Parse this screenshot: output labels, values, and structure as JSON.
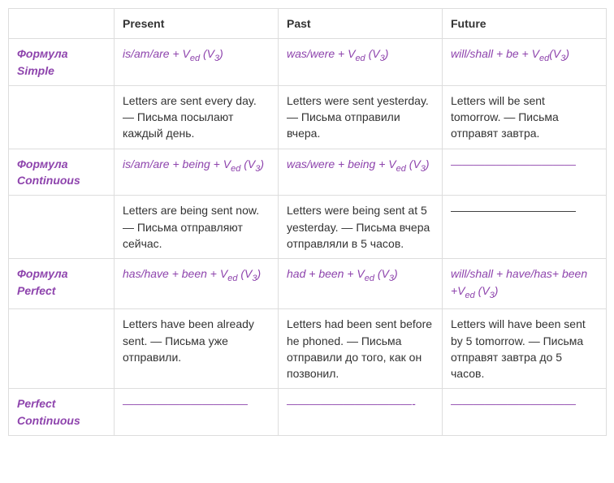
{
  "headers": {
    "present": "Present",
    "past": "Past",
    "future": "Future"
  },
  "rows": {
    "simple": {
      "label": "Формула Simple",
      "formula": {
        "present": {
          "prefix": "is/am/are + V",
          "sub": "ed",
          "suffix": " (V",
          "sub2": "3",
          "tail": ")"
        },
        "past": {
          "prefix": "was/were + V",
          "sub": "ed",
          "suffix": " (V",
          "sub2": "3",
          "tail": ")"
        },
        "future": {
          "prefix": "will/shall + be + V",
          "sub": "ed",
          "suffix": "(V",
          "sub2": "3",
          "tail": ")"
        }
      },
      "example": {
        "present": " Letters are sent every day. — Письма посылают каждый день.",
        "past": " Letters were sent yesterday. — Письма отправили вчера.",
        "future": " Letters will be sent tomorrow. — Письма отправят завтра."
      }
    },
    "continuous": {
      "label": "Формула Continuous",
      "formula": {
        "present": {
          "prefix": "is/am/are + being + V",
          "sub": "ed",
          "suffix": " (V",
          "sub2": "3",
          "tail": ")"
        },
        "past": {
          "prefix": "was/were + being + V",
          "sub": "ed",
          "suffix": " (V",
          "sub2": "3",
          "tail": ")"
        },
        "future": {
          "plain": "———————————"
        }
      },
      "example": {
        "present": " Letters are being sent now. — Письма отправляют сейчас.",
        "past": " Letters were being sent at 5 yesterday. — Письма вчера отправляли в 5 часов.",
        "future": "———————————"
      }
    },
    "perfect": {
      "label": "Формула Perfect",
      "formula": {
        "present": {
          "prefix": "has/have + been + V",
          "sub": "ed",
          "suffix": " (V",
          "sub2": "3",
          "tail": ")"
        },
        "past": {
          "prefix": "had + been + V",
          "sub": "ed",
          "suffix": " (V",
          "sub2": "3",
          "tail": ")"
        },
        "future": {
          "prefix": " will/shall + have/has+ been +V",
          "sub": "ed",
          "suffix": " (V",
          "sub2": "3",
          "tail": ")"
        }
      },
      "example": {
        "present": " Letters have been already sent. — Письма уже отправили.",
        "past": " Letters had been sent before he phoned. — Письма отправили до того, как он позвонил.",
        "future": " Letters will have been sent by 5 tomorrow. — Письма отправят завтра до 5 часов."
      }
    },
    "perfect_continuous": {
      "label": "Perfect Continuous",
      "formula": {
        "present": {
          "plain": "———————————"
        },
        "past": {
          "plain": "———————————-"
        },
        "future": {
          "plain": "———————————"
        }
      }
    }
  }
}
